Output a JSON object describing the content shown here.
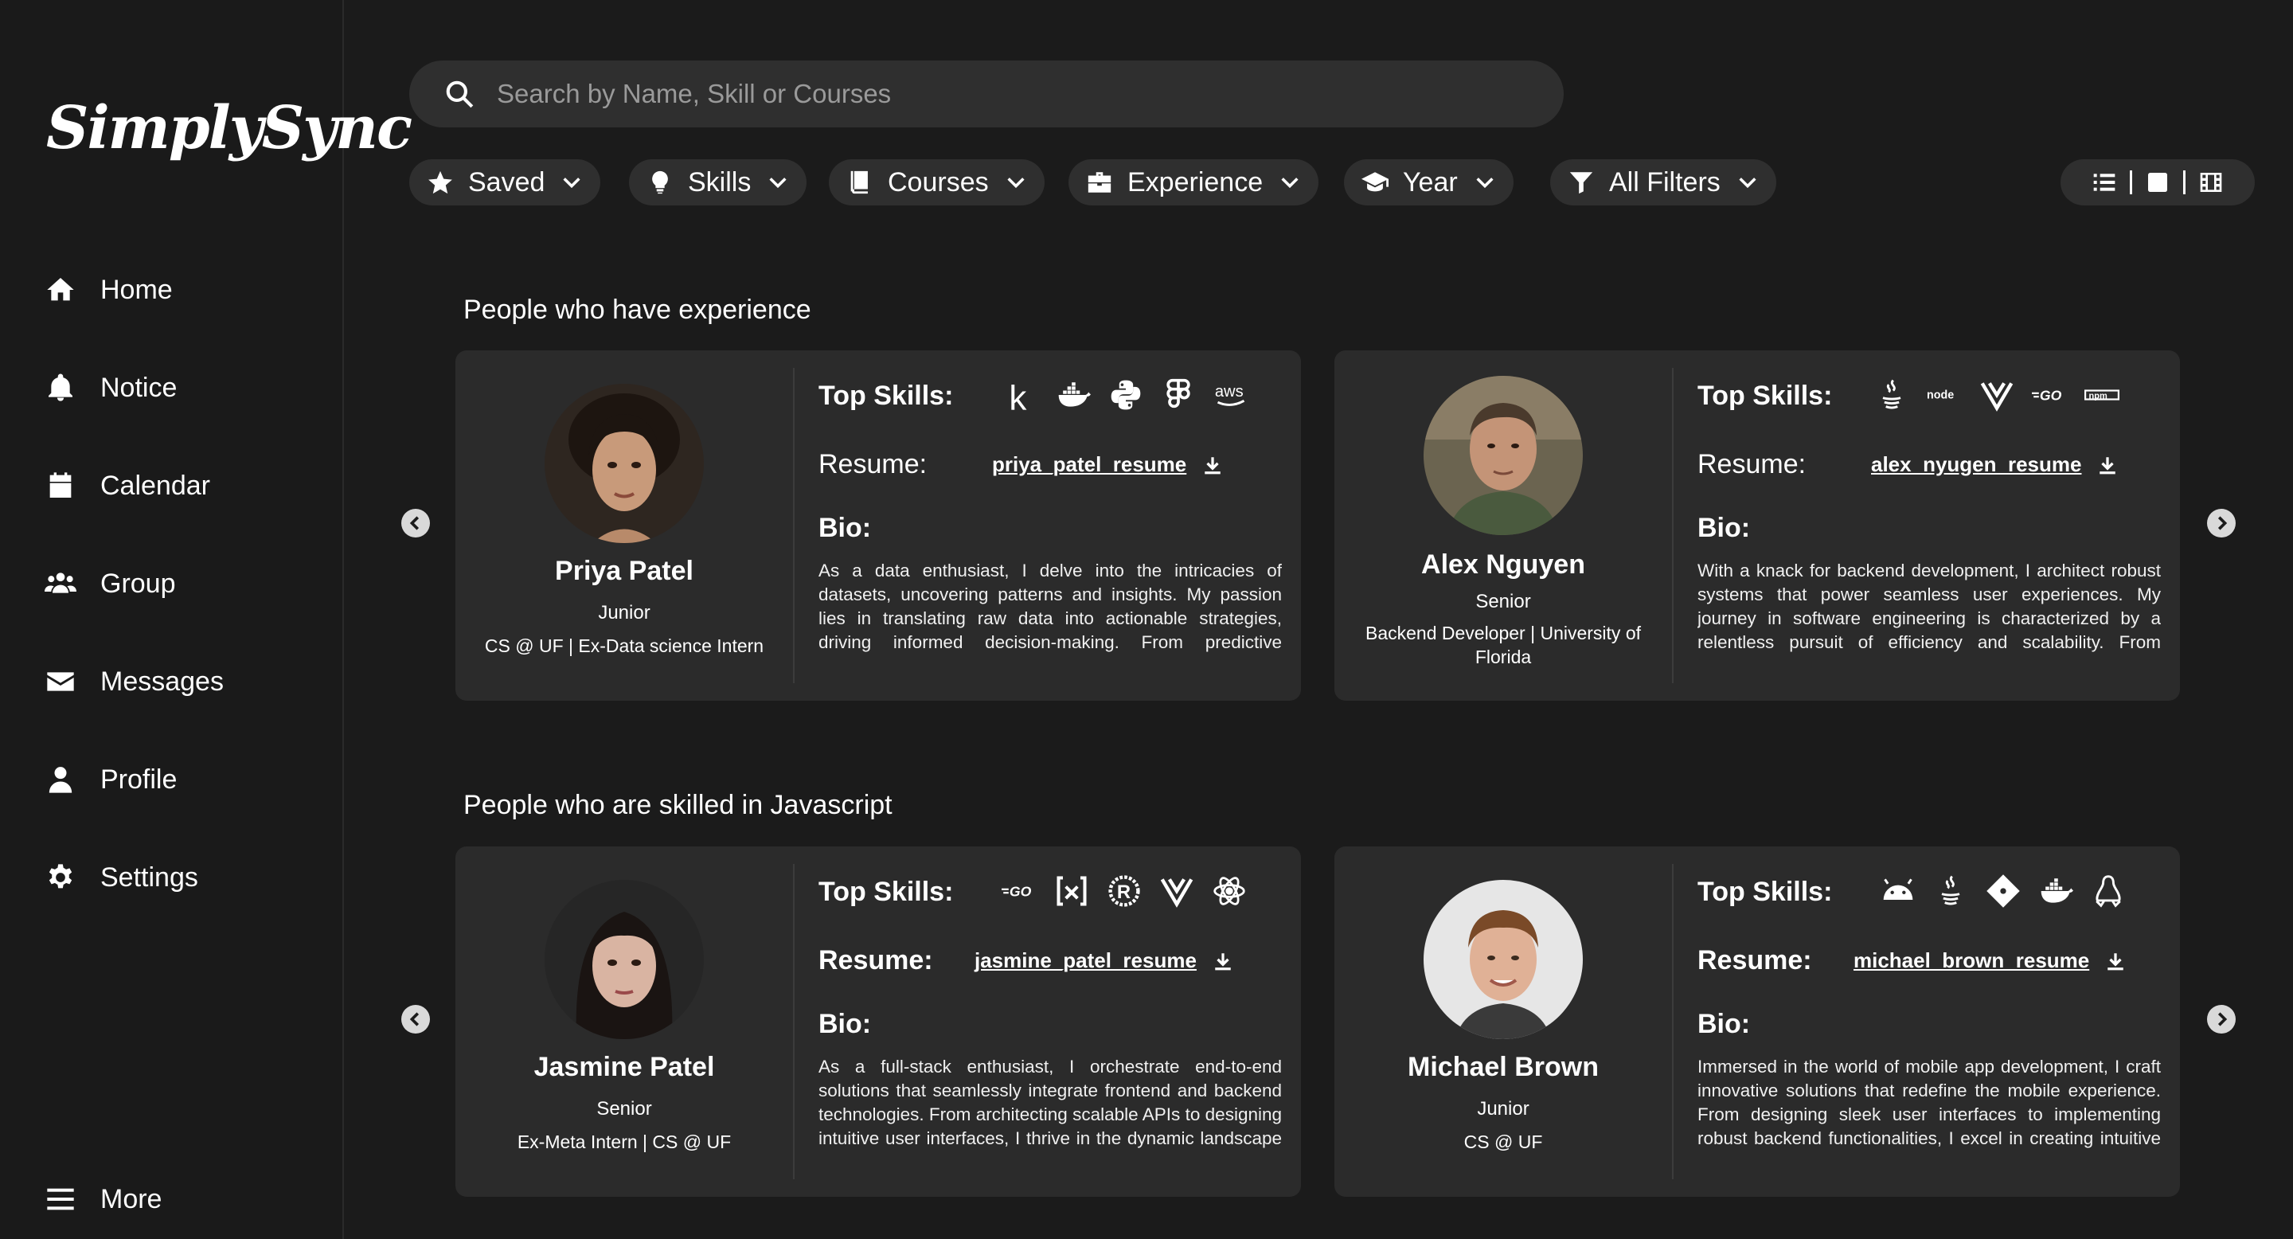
{
  "brand": {
    "logo": "SimplySync"
  },
  "sidebar": {
    "items": [
      {
        "label": "Home",
        "icon": "home-icon"
      },
      {
        "label": "Notice",
        "icon": "bell-icon"
      },
      {
        "label": "Calendar",
        "icon": "calendar-icon"
      },
      {
        "label": "Group",
        "icon": "group-icon"
      },
      {
        "label": "Messages",
        "icon": "envelope-icon"
      },
      {
        "label": "Profile",
        "icon": "user-icon"
      },
      {
        "label": "Settings",
        "icon": "gear-icon"
      }
    ],
    "more": "More"
  },
  "search": {
    "placeholder": "Search by Name, Skill or Courses"
  },
  "filters": [
    {
      "label": "Saved",
      "icon": "star-icon"
    },
    {
      "label": "Skills",
      "icon": "lightbulb-icon"
    },
    {
      "label": "Courses",
      "icon": "book-icon"
    },
    {
      "label": "Experience",
      "icon": "briefcase-icon"
    },
    {
      "label": "Year",
      "icon": "graduation-cap-icon"
    },
    {
      "label": "All Filters",
      "icon": "funnel-icon"
    }
  ],
  "view_toggle": [
    "list-view-icon",
    "single-view-icon",
    "grid-view-icon"
  ],
  "labels": {
    "top_skills": "Top Skills:",
    "resume": "Resume:",
    "bio": "Bio:"
  },
  "sections": [
    {
      "title": "People who have experience",
      "cards": [
        {
          "name": "Priya Patel",
          "level": "Junior",
          "meta": "CS @ UF | Ex-Data science Intern",
          "skills": [
            "kafka-icon",
            "docker-icon",
            "python-icon",
            "figma-icon",
            "aws-icon"
          ],
          "resume": "priya_patel_resume",
          "bio": "As a data enthusiast, I delve into the intricacies of datasets, uncovering patterns and insights. My passion lies in translating raw data into actionable strategies, driving informed decision-making. From predictive modeling to visualization, I thrive on transforming complex data"
        },
        {
          "name": "Alex Nguyen",
          "level": "Senior",
          "meta": "Backend Developer | University of Florida",
          "skills": [
            "java-icon",
            "node-icon",
            "vue-icon",
            "go-icon",
            "npm-icon"
          ],
          "resume": "alex_nyugen_resume",
          "bio": "With a knack for backend development, I architect robust systems that power seamless user experiences. My journey in software engineering is characterized by a relentless pursuit of efficiency and scalability. From optimizing database queries to orchestrating microservices, I thrive"
        }
      ]
    },
    {
      "title": "People who are skilled in Javascript",
      "cards": [
        {
          "name": "Jasmine Patel",
          "level": "Senior",
          "meta": "Ex-Meta Intern | CS @ UF",
          "skills": [
            "go-icon",
            "vscode-icon",
            "rust-icon",
            "vue-icon",
            "react-icon"
          ],
          "resume": "jasmine_patel_resume",
          "bio": "As a full-stack enthusiast, I orchestrate end-to-end solutions that seamlessly integrate frontend and backend technologies. From architecting scalable APIs to designing intuitive user interfaces, I thrive in the dynamic landscape of full-stack development. With a passion for inno-"
        },
        {
          "name": "Michael Brown",
          "level": "Junior",
          "meta": "CS @ UF",
          "skills": [
            "android-icon",
            "java-icon",
            "git-icon",
            "docker-icon",
            "linux-icon"
          ],
          "resume": "michael_brown_resume",
          "bio": "Immersed in the world of mobile app development, I craft innovative solutions that redefine the mobile experience. From designing sleek user interfaces to implementing robust backend functionalities, I excel in creating intuitive and engaging Android applications. With a focus on user-"
        }
      ]
    }
  ]
}
